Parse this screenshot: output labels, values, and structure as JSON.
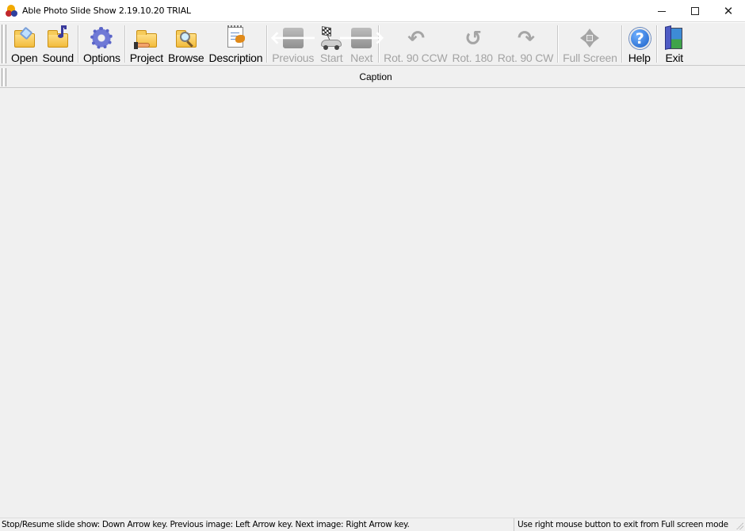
{
  "window": {
    "title": "Able Photo Slide Show 2.19.10.20 TRIAL",
    "controls": {
      "minimize": "minimize",
      "maximize": "maximize",
      "close": "close"
    }
  },
  "toolbar": {
    "groups": [
      {
        "buttons": [
          {
            "id": "open",
            "label": "Open",
            "icon": "open-folder-icon",
            "enabled": true
          },
          {
            "id": "sound",
            "label": "Sound",
            "icon": "sound-folder-icon",
            "enabled": true
          }
        ]
      },
      {
        "buttons": [
          {
            "id": "options",
            "label": "Options",
            "icon": "gear-icon",
            "enabled": true
          }
        ]
      },
      {
        "buttons": [
          {
            "id": "project",
            "label": "Project",
            "icon": "project-folder-icon",
            "enabled": true
          },
          {
            "id": "browse",
            "label": "Browse",
            "icon": "browse-magnifier-icon",
            "enabled": true
          },
          {
            "id": "description",
            "label": "Description",
            "icon": "notepad-icon",
            "enabled": true
          }
        ]
      },
      {
        "buttons": [
          {
            "id": "previous",
            "label": "Previous",
            "icon": "arrow-left-icon",
            "enabled": false
          },
          {
            "id": "start",
            "label": "Start",
            "icon": "race-car-flag-icon",
            "enabled": false
          },
          {
            "id": "next",
            "label": "Next",
            "icon": "arrow-right-icon",
            "enabled": false
          }
        ]
      },
      {
        "buttons": [
          {
            "id": "rot90ccw",
            "label": "Rot. 90 CCW",
            "icon": "rotate-ccw-icon",
            "enabled": false
          },
          {
            "id": "rot180",
            "label": "Rot. 180",
            "icon": "rotate-180-icon",
            "enabled": false
          },
          {
            "id": "rot90cw",
            "label": "Rot. 90 CW",
            "icon": "rotate-cw-icon",
            "enabled": false
          }
        ]
      },
      {
        "buttons": [
          {
            "id": "fullscreen",
            "label": "Full Screen",
            "icon": "move-arrows-icon",
            "enabled": false
          }
        ]
      },
      {
        "buttons": [
          {
            "id": "help",
            "label": "Help",
            "icon": "help-icon",
            "enabled": true
          }
        ]
      },
      {
        "buttons": [
          {
            "id": "exit",
            "label": "Exit",
            "icon": "exit-door-icon",
            "enabled": true
          }
        ]
      }
    ]
  },
  "caption": {
    "label": "Caption"
  },
  "statusbar": {
    "left": "Stop/Resume slide show: Down Arrow key. Previous image: Left Arrow key. Next image: Right Arrow key.",
    "right": "Use right mouse button to exit from Full screen mode"
  }
}
